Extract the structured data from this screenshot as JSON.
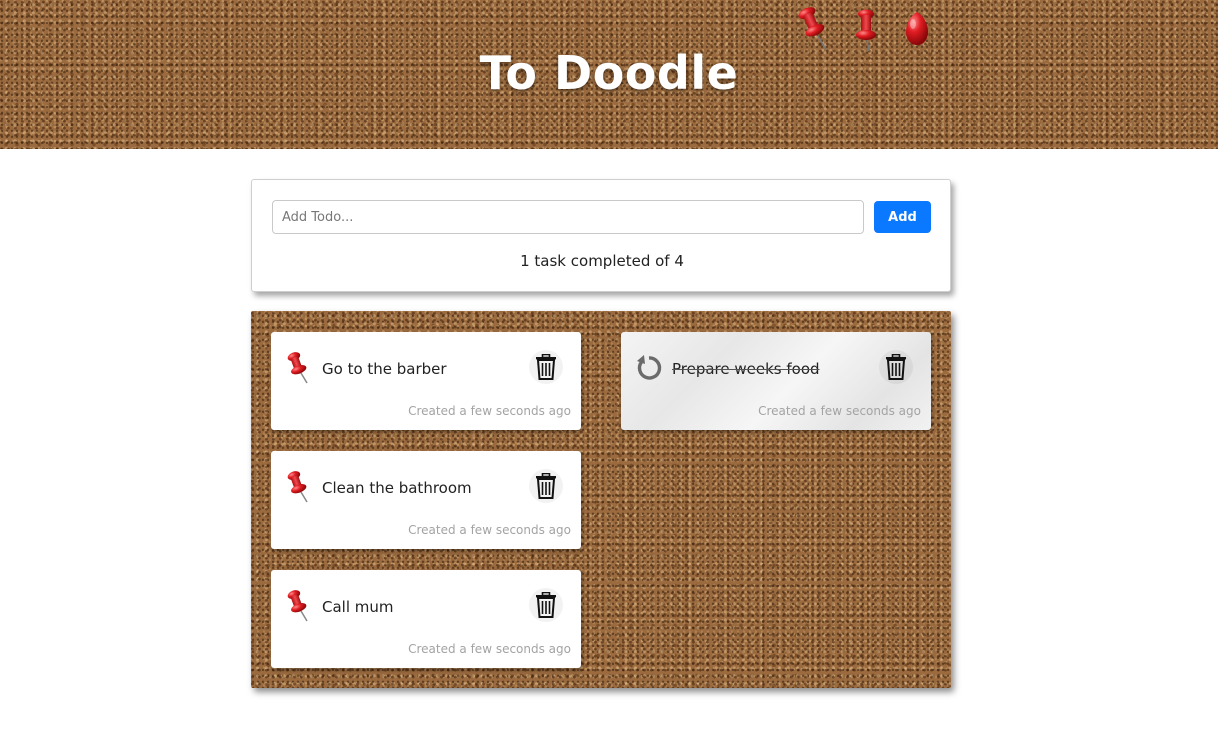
{
  "header": {
    "title": "To Doodle",
    "pins": [
      "pushpin-tilted-icon",
      "pushpin-side-icon",
      "pushpin-front-icon"
    ]
  },
  "add_todo": {
    "placeholder": "Add Todo...",
    "value": "",
    "button_label": "Add",
    "button_color": "#0a78ff"
  },
  "summary": {
    "text": "1 task completed of 4",
    "completed": 1,
    "total": 4
  },
  "todos": [
    {
      "title": "Go to the barber",
      "created": "Created a few seconds ago",
      "completed": false,
      "status_icon": "pushpin-icon",
      "delete_icon": "trash-icon"
    },
    {
      "title": "Prepare weeks food",
      "created": "Created a few seconds ago",
      "completed": true,
      "status_icon": "undo-icon",
      "delete_icon": "trash-icon"
    },
    {
      "title": "Clean the bathroom",
      "created": "Created a few seconds ago",
      "completed": false,
      "status_icon": "pushpin-icon",
      "delete_icon": "trash-icon"
    },
    {
      "title": "Call mum",
      "created": "Created a few seconds ago",
      "completed": false,
      "status_icon": "pushpin-icon",
      "delete_icon": "trash-icon"
    }
  ],
  "colors": {
    "pin_red": "#d0161b",
    "cork": "#9b6b3f"
  }
}
